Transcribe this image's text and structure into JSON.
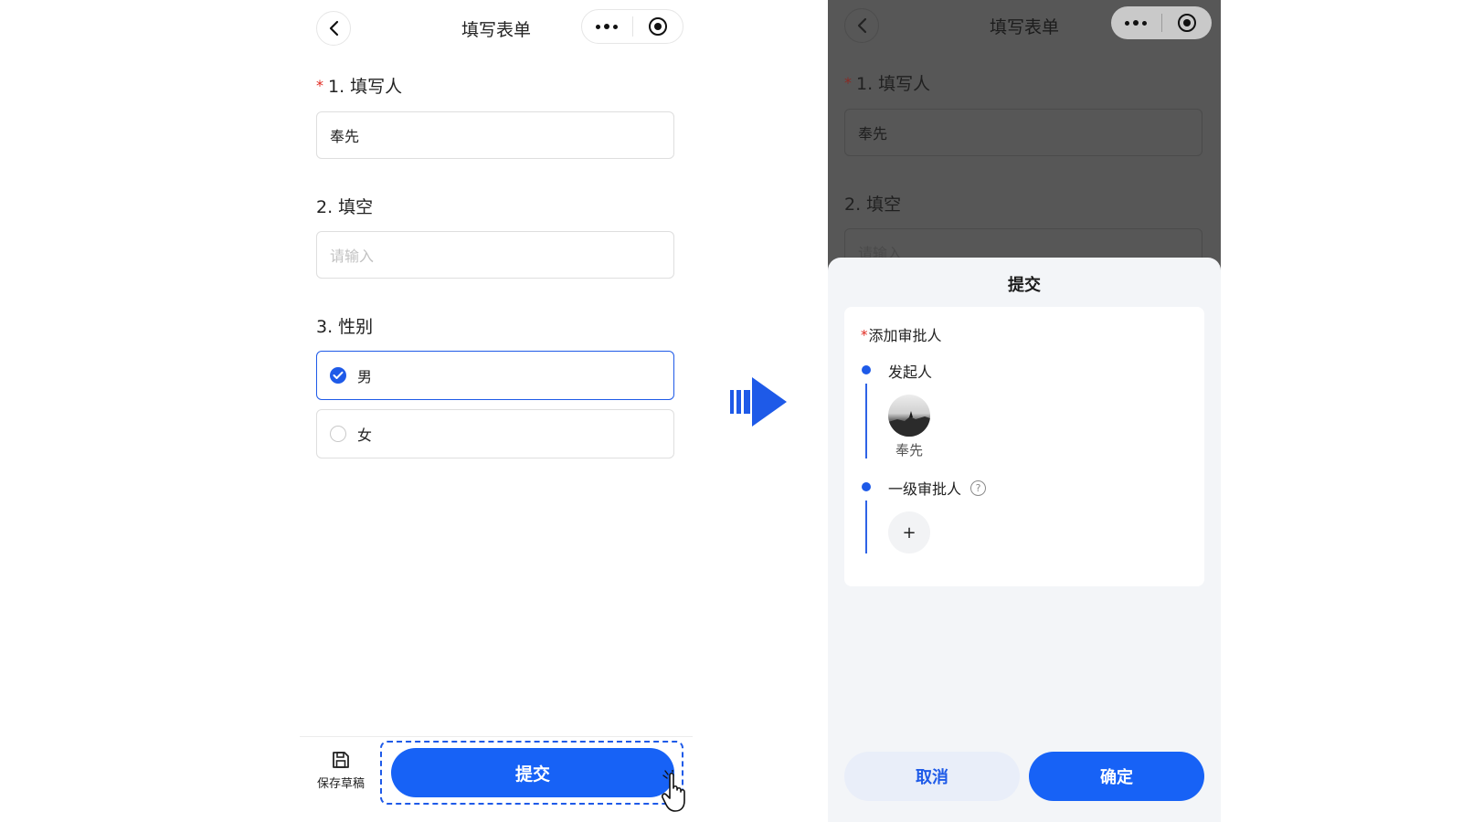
{
  "left": {
    "nav": {
      "title": "填写表单"
    },
    "questions": [
      {
        "index_label": "1. 填写人",
        "required": true,
        "required_mark": "*",
        "value": "奉先"
      },
      {
        "index_label": "2. 填空",
        "required": false,
        "placeholder": "请输入"
      },
      {
        "index_label": "3. 性别",
        "options": [
          {
            "label": "男",
            "selected": true
          },
          {
            "label": "女",
            "selected": false
          }
        ]
      }
    ],
    "bottom_bar": {
      "draft_label": "保存草稿",
      "submit_label": "提交"
    }
  },
  "right": {
    "nav": {
      "title": "填写表单"
    },
    "background_form": {
      "q1_label": "1. 填写人",
      "q1_mark": "*",
      "q1_value": "奉先",
      "q2_label": "2. 填空",
      "q2_placeholder": "请输入"
    },
    "sheet": {
      "title": "提交",
      "approver_section": {
        "required_mark": "*",
        "title": "添加审批人"
      },
      "nodes": [
        {
          "label": "发起人",
          "person": "奉先"
        },
        {
          "label": "一级审批人",
          "help_icon": "question-circle-icon",
          "add_symbol": "+"
        }
      ],
      "cancel_label": "取消",
      "confirm_label": "确定"
    }
  },
  "colors": {
    "primary": "#1762f6",
    "required": "#e0281f",
    "overlay": "#575757",
    "sheet_bg": "#f3f5f8"
  }
}
